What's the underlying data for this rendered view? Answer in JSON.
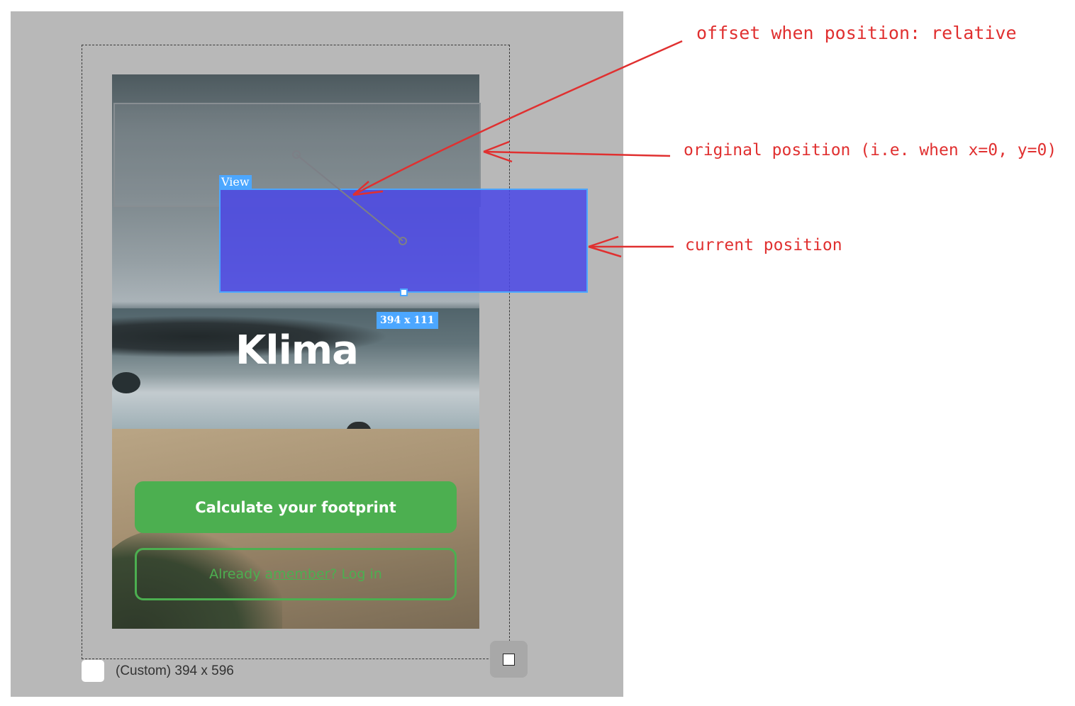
{
  "view": {
    "tag_label": "View",
    "size_badge": "394 x 111"
  },
  "app": {
    "title": "Klima",
    "primary_button": "Calculate your footprint",
    "secondary_prefix": "Already a ",
    "secondary_link": "member",
    "secondary_suffix": "? Log in"
  },
  "device": {
    "label": "(Custom) 394 x 596"
  },
  "annotations": {
    "offset": "offset when position: relative",
    "original": "original position (i.e. when x=0, y=0)",
    "current": "current position"
  },
  "colors": {
    "accent_green": "#4caf50",
    "selection_blue": "#4ca7ff",
    "view_fill": "#4a46e6",
    "annotation_red": "#e03030"
  }
}
